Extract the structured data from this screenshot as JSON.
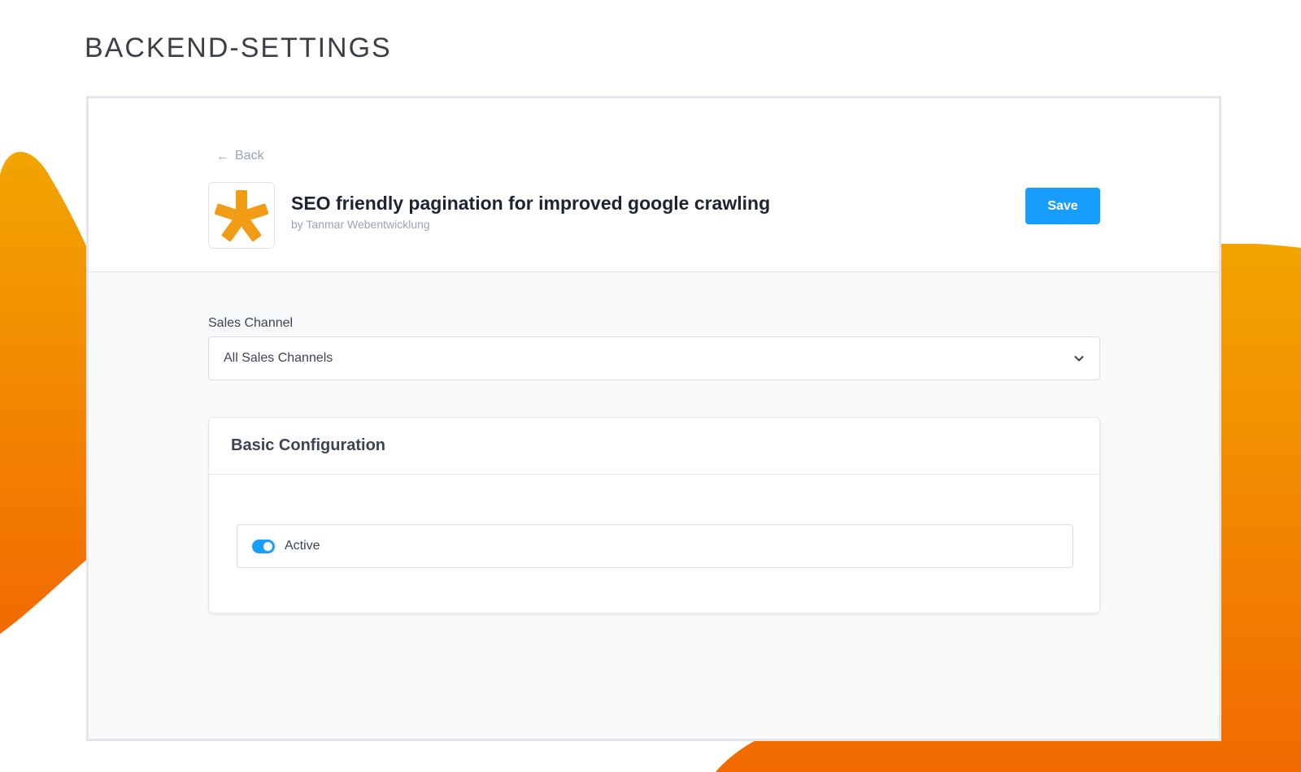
{
  "page_heading": "BACKEND-SETTINGS",
  "colors": {
    "accent": "#189eff",
    "brand_orange_top": "#f2a500",
    "brand_orange_bottom": "#f26a00"
  },
  "header": {
    "back_label": "Back",
    "back_icon": "arrow-left-icon",
    "plugin_logo_icon": "asterisk-logo-icon",
    "plugin_title": "SEO friendly pagination for improved google crawling",
    "plugin_author": "by Tanmar Webentwicklung",
    "save_label": "Save"
  },
  "sales_channel": {
    "label": "Sales Channel",
    "selected": "All Sales Channels",
    "icon": "chevron-down-icon"
  },
  "config_card": {
    "title": "Basic Configuration",
    "fields": [
      {
        "label": "Active",
        "type": "toggle",
        "checked": true
      }
    ]
  }
}
